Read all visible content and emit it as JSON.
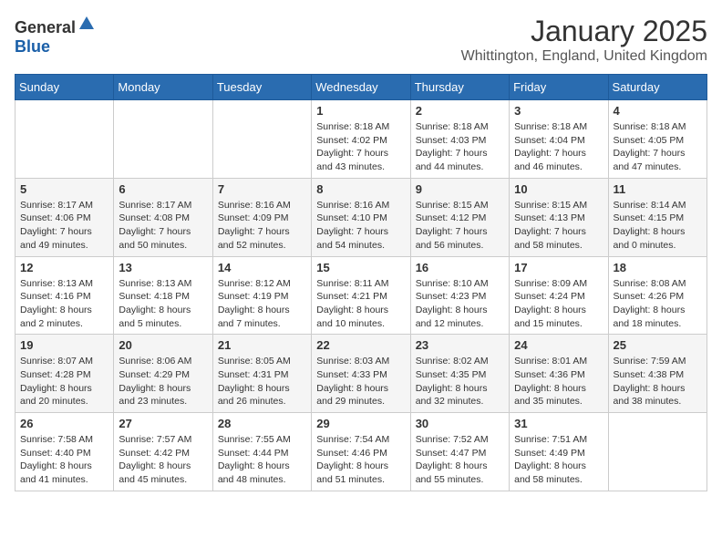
{
  "header": {
    "logo_general": "General",
    "logo_blue": "Blue",
    "month": "January 2025",
    "location": "Whittington, England, United Kingdom"
  },
  "weekdays": [
    "Sunday",
    "Monday",
    "Tuesday",
    "Wednesday",
    "Thursday",
    "Friday",
    "Saturday"
  ],
  "weeks": [
    [
      {
        "day": "",
        "info": ""
      },
      {
        "day": "",
        "info": ""
      },
      {
        "day": "",
        "info": ""
      },
      {
        "day": "1",
        "info": "Sunrise: 8:18 AM\nSunset: 4:02 PM\nDaylight: 7 hours and 43 minutes."
      },
      {
        "day": "2",
        "info": "Sunrise: 8:18 AM\nSunset: 4:03 PM\nDaylight: 7 hours and 44 minutes."
      },
      {
        "day": "3",
        "info": "Sunrise: 8:18 AM\nSunset: 4:04 PM\nDaylight: 7 hours and 46 minutes."
      },
      {
        "day": "4",
        "info": "Sunrise: 8:18 AM\nSunset: 4:05 PM\nDaylight: 7 hours and 47 minutes."
      }
    ],
    [
      {
        "day": "5",
        "info": "Sunrise: 8:17 AM\nSunset: 4:06 PM\nDaylight: 7 hours and 49 minutes."
      },
      {
        "day": "6",
        "info": "Sunrise: 8:17 AM\nSunset: 4:08 PM\nDaylight: 7 hours and 50 minutes."
      },
      {
        "day": "7",
        "info": "Sunrise: 8:16 AM\nSunset: 4:09 PM\nDaylight: 7 hours and 52 minutes."
      },
      {
        "day": "8",
        "info": "Sunrise: 8:16 AM\nSunset: 4:10 PM\nDaylight: 7 hours and 54 minutes."
      },
      {
        "day": "9",
        "info": "Sunrise: 8:15 AM\nSunset: 4:12 PM\nDaylight: 7 hours and 56 minutes."
      },
      {
        "day": "10",
        "info": "Sunrise: 8:15 AM\nSunset: 4:13 PM\nDaylight: 7 hours and 58 minutes."
      },
      {
        "day": "11",
        "info": "Sunrise: 8:14 AM\nSunset: 4:15 PM\nDaylight: 8 hours and 0 minutes."
      }
    ],
    [
      {
        "day": "12",
        "info": "Sunrise: 8:13 AM\nSunset: 4:16 PM\nDaylight: 8 hours and 2 minutes."
      },
      {
        "day": "13",
        "info": "Sunrise: 8:13 AM\nSunset: 4:18 PM\nDaylight: 8 hours and 5 minutes."
      },
      {
        "day": "14",
        "info": "Sunrise: 8:12 AM\nSunset: 4:19 PM\nDaylight: 8 hours and 7 minutes."
      },
      {
        "day": "15",
        "info": "Sunrise: 8:11 AM\nSunset: 4:21 PM\nDaylight: 8 hours and 10 minutes."
      },
      {
        "day": "16",
        "info": "Sunrise: 8:10 AM\nSunset: 4:23 PM\nDaylight: 8 hours and 12 minutes."
      },
      {
        "day": "17",
        "info": "Sunrise: 8:09 AM\nSunset: 4:24 PM\nDaylight: 8 hours and 15 minutes."
      },
      {
        "day": "18",
        "info": "Sunrise: 8:08 AM\nSunset: 4:26 PM\nDaylight: 8 hours and 18 minutes."
      }
    ],
    [
      {
        "day": "19",
        "info": "Sunrise: 8:07 AM\nSunset: 4:28 PM\nDaylight: 8 hours and 20 minutes."
      },
      {
        "day": "20",
        "info": "Sunrise: 8:06 AM\nSunset: 4:29 PM\nDaylight: 8 hours and 23 minutes."
      },
      {
        "day": "21",
        "info": "Sunrise: 8:05 AM\nSunset: 4:31 PM\nDaylight: 8 hours and 26 minutes."
      },
      {
        "day": "22",
        "info": "Sunrise: 8:03 AM\nSunset: 4:33 PM\nDaylight: 8 hours and 29 minutes."
      },
      {
        "day": "23",
        "info": "Sunrise: 8:02 AM\nSunset: 4:35 PM\nDaylight: 8 hours and 32 minutes."
      },
      {
        "day": "24",
        "info": "Sunrise: 8:01 AM\nSunset: 4:36 PM\nDaylight: 8 hours and 35 minutes."
      },
      {
        "day": "25",
        "info": "Sunrise: 7:59 AM\nSunset: 4:38 PM\nDaylight: 8 hours and 38 minutes."
      }
    ],
    [
      {
        "day": "26",
        "info": "Sunrise: 7:58 AM\nSunset: 4:40 PM\nDaylight: 8 hours and 41 minutes."
      },
      {
        "day": "27",
        "info": "Sunrise: 7:57 AM\nSunset: 4:42 PM\nDaylight: 8 hours and 45 minutes."
      },
      {
        "day": "28",
        "info": "Sunrise: 7:55 AM\nSunset: 4:44 PM\nDaylight: 8 hours and 48 minutes."
      },
      {
        "day": "29",
        "info": "Sunrise: 7:54 AM\nSunset: 4:46 PM\nDaylight: 8 hours and 51 minutes."
      },
      {
        "day": "30",
        "info": "Sunrise: 7:52 AM\nSunset: 4:47 PM\nDaylight: 8 hours and 55 minutes."
      },
      {
        "day": "31",
        "info": "Sunrise: 7:51 AM\nSunset: 4:49 PM\nDaylight: 8 hours and 58 minutes."
      },
      {
        "day": "",
        "info": ""
      }
    ]
  ]
}
